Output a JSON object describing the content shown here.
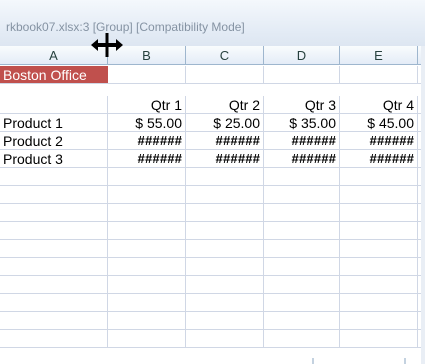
{
  "window": {
    "title": "rkbook07.xlsx:3  [Group]  [Compatibility Mode]"
  },
  "columns": [
    "A",
    "B",
    "C",
    "D",
    "E"
  ],
  "sheet": {
    "banner": "Boston Office",
    "quarters": [
      "Qtr 1",
      "Qtr 2",
      "Qtr 3",
      "Qtr 4"
    ],
    "products": [
      {
        "name": "Product 1",
        "values": [
          "$ 55.00",
          "$ 25.00",
          "$ 35.00",
          "$ 45.00"
        ]
      },
      {
        "name": "Product 2",
        "values": [
          "######",
          "######",
          "######",
          "######"
        ]
      },
      {
        "name": "Product 3",
        "values": [
          "######",
          "######",
          "######",
          "######"
        ]
      }
    ]
  },
  "colors": {
    "banner_fill": "#c0504d",
    "header_fill": "#e4ecf7",
    "gridline": "#d0d7e5"
  },
  "cursor": {
    "icon": "column-resize-cursor-icon"
  }
}
